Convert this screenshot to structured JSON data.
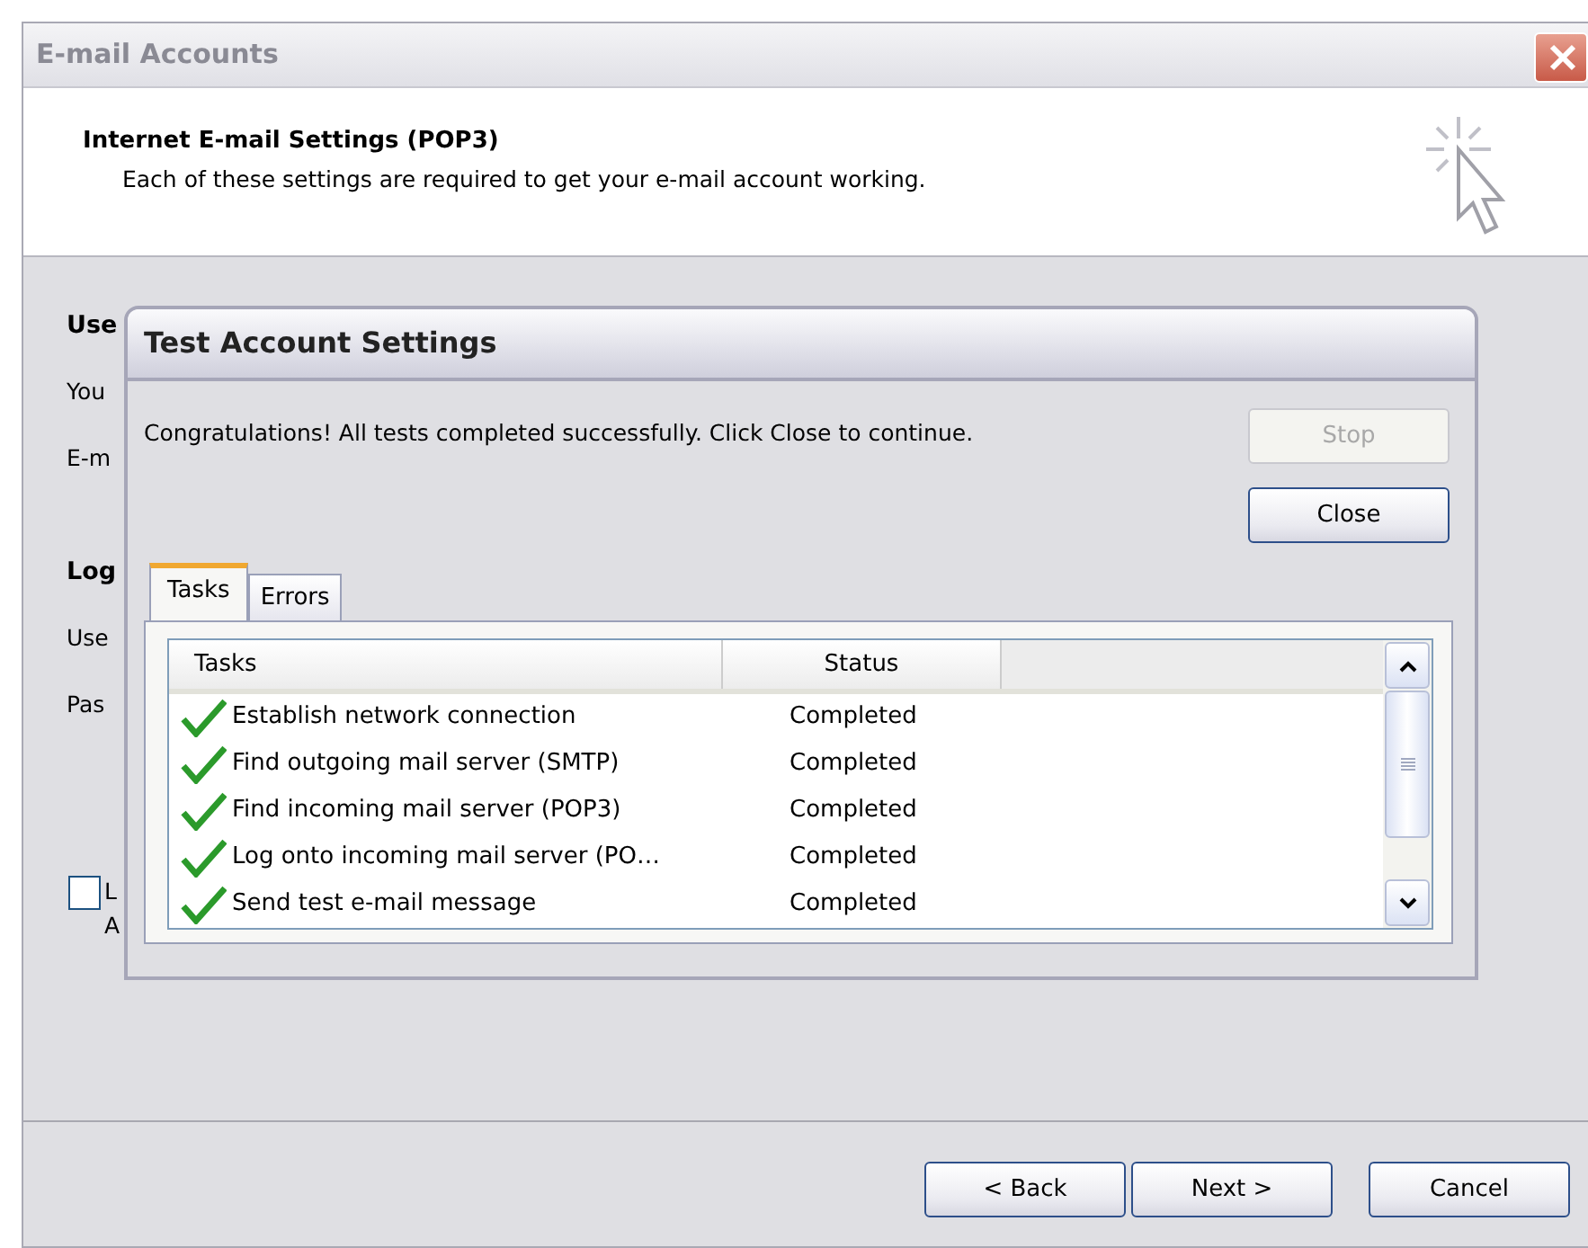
{
  "window": {
    "title": "E-mail Accounts"
  },
  "header": {
    "title": "Internet E-mail Settings (POP3)",
    "subtitle": "Each of these settings are required to get your e-mail account working."
  },
  "background_form": [
    {
      "kind": "heading",
      "text": "Use"
    },
    {
      "kind": "label",
      "text": "You"
    },
    {
      "kind": "label",
      "text": "E-m"
    },
    {
      "kind": "heading",
      "text": "Log"
    },
    {
      "kind": "label",
      "text": "Use"
    },
    {
      "kind": "label",
      "text": "Pas"
    }
  ],
  "background_checkbox": {
    "checked": false,
    "label_lines": [
      "L",
      "A"
    ]
  },
  "dialog": {
    "title": "Test Account Settings",
    "message": "Congratulations! All tests completed successfully. Click Close to continue.",
    "buttons": [
      {
        "label": "Stop",
        "disabled": true
      },
      {
        "label": "Close",
        "disabled": false
      }
    ],
    "tabs": [
      {
        "label": "Tasks",
        "selected": true
      },
      {
        "label": "Errors",
        "selected": false
      }
    ],
    "table": {
      "columns": [
        "Tasks",
        "Status"
      ],
      "rows": [
        {
          "task": "Establish network connection",
          "status": "Completed",
          "done": true
        },
        {
          "task": "Find outgoing mail server (SMTP)",
          "status": "Completed",
          "done": true
        },
        {
          "task": "Find incoming mail server (POP3)",
          "status": "Completed",
          "done": true
        },
        {
          "task": "Log onto incoming mail server (PO…",
          "status": "Completed",
          "done": true
        },
        {
          "task": "Send test e-mail message",
          "status": "Completed",
          "done": true
        }
      ]
    }
  },
  "buttons": [
    {
      "label": "< Back"
    },
    {
      "label": "Next >"
    },
    {
      "label": "Cancel"
    }
  ]
}
